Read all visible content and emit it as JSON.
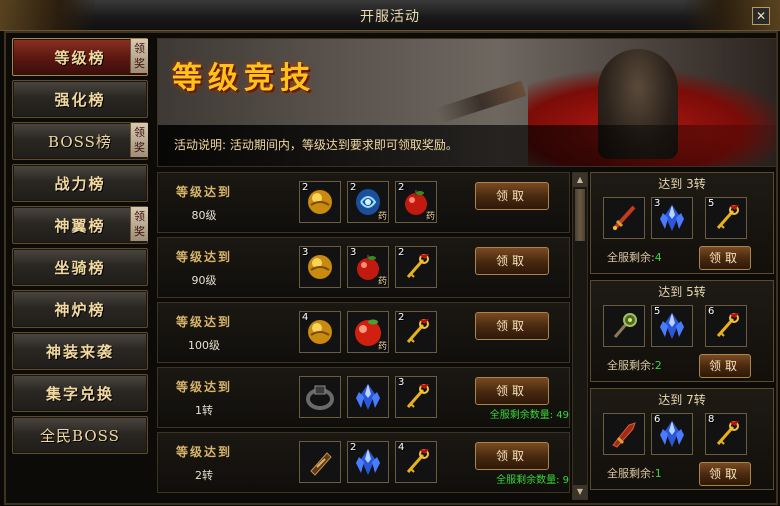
{
  "window": {
    "title": "开服活动",
    "close_label": "✕"
  },
  "menu": [
    {
      "label": "等级榜",
      "badge": "领奖",
      "active": true
    },
    {
      "label": "强化榜",
      "badge": ""
    },
    {
      "label": "BOSS榜",
      "badge": "领奖"
    },
    {
      "label": "战力榜",
      "badge": ""
    },
    {
      "label": "神翼榜",
      "badge": "领奖"
    },
    {
      "label": "坐骑榜",
      "badge": ""
    },
    {
      "label": "神炉榜",
      "badge": ""
    },
    {
      "label": "神装来袭",
      "badge": ""
    },
    {
      "label": "集字兑换",
      "badge": ""
    },
    {
      "label": "全民BOSS",
      "badge": ""
    }
  ],
  "banner": {
    "title": "等级竞技",
    "desc_label": "活动说明:",
    "desc_text": "活动期间内，等级达到要求即可领取奖励。"
  },
  "rows": [
    {
      "title": "等级达到",
      "level": "80级",
      "button": "领取",
      "remain": "",
      "items": [
        {
          "icon": "gold-orb",
          "count": "2",
          "tag": ""
        },
        {
          "icon": "blue-swirl-gem",
          "count": "2",
          "tag": "药"
        },
        {
          "icon": "red-apple",
          "count": "2",
          "tag": "药"
        }
      ]
    },
    {
      "title": "等级达到",
      "level": "90级",
      "button": "领取",
      "remain": "",
      "items": [
        {
          "icon": "gold-orb",
          "count": "3",
          "tag": ""
        },
        {
          "icon": "red-apple",
          "count": "3",
          "tag": "药"
        },
        {
          "icon": "golden-key",
          "count": "2",
          "tag": ""
        }
      ]
    },
    {
      "title": "等级达到",
      "level": "100级",
      "button": "领取",
      "remain": "",
      "items": [
        {
          "icon": "gold-orb",
          "count": "4",
          "tag": ""
        },
        {
          "icon": "red-apple-large",
          "count": "",
          "tag": "药"
        },
        {
          "icon": "golden-key",
          "count": "2",
          "tag": ""
        }
      ]
    },
    {
      "title": "等级达到",
      "level": "1转",
      "button": "领取",
      "remain": "全服剩余数量: 49",
      "items": [
        {
          "icon": "dark-ring",
          "count": "",
          "tag": ""
        },
        {
          "icon": "blue-crystal",
          "count": "",
          "tag": ""
        },
        {
          "icon": "golden-key",
          "count": "3",
          "tag": ""
        }
      ]
    },
    {
      "title": "等级达到",
      "level": "2转",
      "button": "领取",
      "remain": "全服剩余数量: 9",
      "items": [
        {
          "icon": "bracer",
          "count": "",
          "tag": ""
        },
        {
          "icon": "blue-crystal",
          "count": "2",
          "tag": ""
        },
        {
          "icon": "golden-key",
          "count": "4",
          "tag": ""
        }
      ]
    }
  ],
  "right_cards": [
    {
      "title": "达到 3转",
      "remain_label": "全服剩余:",
      "remain_value": "4",
      "button": "领取",
      "items": [
        {
          "icon": "red-sword",
          "count": ""
        },
        {
          "icon": "blue-crystal",
          "count": "3"
        },
        {
          "icon": "golden-key",
          "count": "5"
        }
      ]
    },
    {
      "title": "达到 5转",
      "remain_label": "全服剩余:",
      "remain_value": "2",
      "button": "领取",
      "items": [
        {
          "icon": "green-mace",
          "count": ""
        },
        {
          "icon": "blue-crystal",
          "count": "5"
        },
        {
          "icon": "golden-key",
          "count": "6"
        }
      ]
    },
    {
      "title": "达到 7转",
      "remain_label": "全服剩余:",
      "remain_value": "1",
      "button": "领取",
      "items": [
        {
          "icon": "red-blade",
          "count": ""
        },
        {
          "icon": "blue-crystal",
          "count": "6"
        },
        {
          "icon": "golden-key",
          "count": "8"
        }
      ]
    }
  ],
  "scrollbar": {
    "up": "▲",
    "down": "▼"
  }
}
